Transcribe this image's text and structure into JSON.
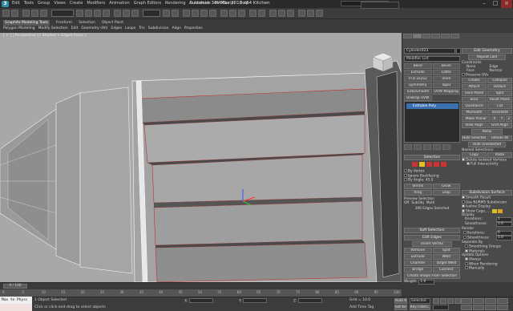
{
  "app": {
    "title": "Autodesk 3ds Max  2012 x64    Kitchen",
    "logo_letter": "3",
    "menu": [
      "Edit",
      "Tools",
      "Group",
      "Views",
      "Create",
      "Modifiers",
      "Animation",
      "Graph Editors",
      "Rendering",
      "Customize",
      "MAXScript",
      "Help"
    ]
  },
  "toolbar": {
    "selection_set_placeholder": ""
  },
  "ribbon": {
    "tabs": [
      "Graphite Modeling Tools",
      "Freeform",
      "Selection",
      "Object Paint"
    ],
    "active_tab": "Graphite Modeling Tools",
    "sub_items": [
      "Polygon Modeling",
      "Modify Selection",
      "Edit",
      "Geometry (All)",
      "Edges",
      "Loops",
      "Tris",
      "Subdivision",
      "Align",
      "Properties"
    ]
  },
  "viewport": {
    "label": "[ + ] [ Perspective ] [ Shaded + Edged Faces ]",
    "bg_color": "#a8a8a8"
  },
  "command_panel": {
    "object_name": "Cylinder023",
    "modifier_list": "Modifier List",
    "modifier_buttons": [
      "Bend",
      "Bevel",
      "Extrude",
      "Lathe",
      "FFD 2x2x2",
      "Shell",
      "Symmetry",
      "Taper",
      "TurboSmooth",
      "UVW Mapping",
      "Unwrap UVW"
    ],
    "stack_item": "Editable Poly",
    "selection": {
      "title": "Selection",
      "by_vertex": "By Vertex",
      "ignore_backfacing": "Ignore Backfacing",
      "by_angle": "By Angle:",
      "by_angle_value": "45.0",
      "shrink": "Shrink",
      "grow": "Grow",
      "ring": "Ring",
      "loop": "Loop",
      "preview_selection": "Preview Selection",
      "preview_opts": [
        "Off",
        "SubObj",
        "Multi"
      ],
      "status": "396 Edges Selected"
    },
    "soft_selection": {
      "title": "Soft Selection"
    },
    "edit_edges": {
      "title": "Edit Edges",
      "insert_vertex": "Insert Vertex",
      "remove": "Remove",
      "split": "Split",
      "extrude": "Extrude",
      "weld": "Weld",
      "chamfer": "Chamfer",
      "target_weld": "Target Weld",
      "bridge": "Bridge",
      "connect": "Connect",
      "create_shape": "Create Shape From Selection",
      "weight_label": "Weight:",
      "weight_value": "1.0"
    },
    "edit_geometry": {
      "title": "Edit Geometry",
      "repeat_last": "Repeat Last",
      "constraints": "Constraints",
      "opts": [
        "None",
        "Edge",
        "Face",
        "Normal"
      ],
      "preserve_uvs": "Preserve UVs",
      "create": "Create",
      "collapse": "Collapse",
      "attach": "Attach",
      "detach": "Detach",
      "slice_plane": "Slice Plane",
      "split": "Split",
      "slice": "Slice",
      "reset_plane": "Reset Plane",
      "quickslice": "QuickSlice",
      "cut": "Cut",
      "msmooth": "MSmooth",
      "tessellate": "Tessellate",
      "make_planar": "Make Planar",
      "xyz": [
        "X",
        "Y",
        "Z"
      ],
      "view_align": "View Align",
      "grid_align": "Grid Align",
      "relax": "Relax",
      "hide_selected": "Hide Selected",
      "unhide_all": "Unhide All",
      "hide_unselected": "Hide Unselected",
      "named_selections": "Named Selections:",
      "copy": "Copy",
      "paste": "Paste",
      "delete_isolated": "Delete Isolated Vertices",
      "full_interactivity": "Full Interactivity"
    },
    "subdivision_surface": {
      "title": "Subdivision Surface",
      "smooth_result": "Smooth Result",
      "use_nurms": "Use NURMS Subdivision",
      "isoline_display": "Isoline Display",
      "show_cage": "Show Cage......",
      "display": "Display",
      "iterations_label": "Iterations:",
      "iterations_value": "1",
      "smoothness_label": "Smoothness:",
      "smoothness_value": "1.0",
      "render": "Render",
      "r_iterations": "Iterations:",
      "r_iter_value": "0",
      "r_smoothness": "Smoothness:",
      "r_smooth_value": "1.0",
      "separate_by": "Separate By",
      "smoothing_groups": "Smoothing Groups",
      "materials": "Materials",
      "update_options": "Update Options",
      "always": "Always",
      "when_rendering": "When Rendering",
      "manually": "Manually",
      "cage_color_1": "#d8c028",
      "cage_color_2": "#e0a020"
    }
  },
  "timeline": {
    "frame": "0 / 100",
    "ticks": [
      "0",
      "5",
      "10",
      "15",
      "20",
      "25",
      "30",
      "35",
      "40",
      "45",
      "50",
      "55",
      "60",
      "65",
      "70",
      "75",
      "80",
      "85",
      "90",
      "95",
      "100"
    ]
  },
  "status": {
    "maxscript": "Max to Physc",
    "line1": "1 Object Selected",
    "line2": "Click or click-and-drag to select objects",
    "x_label": "X:",
    "y_label": "Y:",
    "z_label": "Z:",
    "grid": "Grid = 10.0",
    "add_time_tag": "Add Time Tag",
    "auto_key": "Auto Key",
    "set_key": "Set Key",
    "selected": "Selected",
    "key_filters": "Key Filters..."
  }
}
